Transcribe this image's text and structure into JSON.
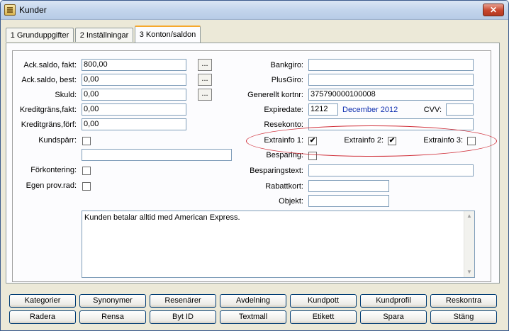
{
  "window": {
    "title": "Kunder",
    "close_glyph": "✕",
    "icon": "app-icon"
  },
  "tabs": [
    {
      "label": "1 Grunduppgifter",
      "active": false
    },
    {
      "label": "2 Inställningar",
      "active": false
    },
    {
      "label": "3 Konton/saldon",
      "active": true
    }
  ],
  "left": {
    "ack_saldo_fakt": {
      "label": "Ack.saldo, fakt:",
      "value": "800,00"
    },
    "ack_saldo_best": {
      "label": "Ack.saldo, best:",
      "value": "0,00"
    },
    "skuld": {
      "label": "Skuld:",
      "value": "0,00"
    },
    "kreditgrans_fakt": {
      "label": "Kreditgräns,fakt:",
      "value": "0,00"
    },
    "kreditgrans_forf": {
      "label": "Kreditgräns,förf:",
      "value": "0,00"
    },
    "kundsparr": {
      "label": "Kundspärr:",
      "checked": false,
      "text_value": ""
    },
    "forkontering": {
      "label": "Förkontering:",
      "checked": false
    },
    "egen_prov_rad": {
      "label": "Egen prov.rad:",
      "checked": false
    },
    "ellipsis": "..."
  },
  "right": {
    "bankgiro": {
      "label": "Bankgiro:",
      "value": ""
    },
    "plusgiro": {
      "label": "PlusGiro:",
      "value": ""
    },
    "kortnr": {
      "label": "Generellt kortnr:",
      "value": "375790000100008"
    },
    "expiredate": {
      "label": "Expiredate:",
      "value": "1212",
      "text": "December 2012"
    },
    "cvv": {
      "label": "CVV:",
      "value": ""
    },
    "resekonto": {
      "label": "Resekonto:",
      "value": ""
    },
    "extrainfo1": {
      "label": "Extrainfo 1:",
      "checked": true
    },
    "extrainfo2": {
      "label": "Extrainfo 2:",
      "checked": true
    },
    "extrainfo3": {
      "label": "Extrainfo 3:",
      "checked": false
    },
    "besparing": {
      "label": "Besparing:",
      "checked": false
    },
    "besparingstext": {
      "label": "Besparingstext:",
      "value": ""
    },
    "rabattkort": {
      "label": "Rabattkort:",
      "value": ""
    },
    "objekt": {
      "label": "Objekt:",
      "value": ""
    }
  },
  "memo": {
    "text": "Kunden betalar alltid med American Express."
  },
  "buttons_row1": [
    "Kategorier",
    "Synonymer",
    "Resenärer",
    "Avdelning",
    "Kundpott",
    "Kundprofil",
    "Reskontra"
  ],
  "buttons_row2": [
    "Radera",
    "Rensa",
    "Byt ID",
    "Textmall",
    "Etikett",
    "Spara",
    "Stäng"
  ],
  "check_glyph": "✔",
  "scroll": {
    "up": "▲",
    "down": "▼"
  },
  "colors": {
    "highlight_ellipse": "#d0303a",
    "date_text": "#1030b0",
    "active_tab_accent": "#f6a82c"
  }
}
